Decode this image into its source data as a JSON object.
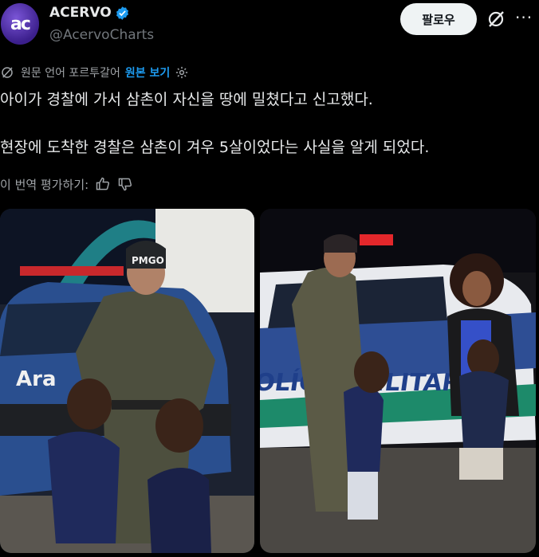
{
  "profile": {
    "avatar_text": "ac",
    "display_name": "ACERVO",
    "handle": "@AcervoCharts",
    "follow_label": "팔로우"
  },
  "translation": {
    "source_label": "원문 언어 포르투갈어",
    "show_original_label": "원본 보기"
  },
  "tweet": {
    "line1": "아이가 경찰에 가서 삼촌이 자신을 땅에 밀쳤다고 신고했다.",
    "line2": "현장에 도착한 경찰은 삼촌이 겨우 5살이었다는 사실을 알게 되었다."
  },
  "rate": {
    "label": "이 번역 평가하기:"
  },
  "colors": {
    "background": "#000000",
    "text": "#e7e9ea",
    "muted": "#71767b",
    "link": "#1d9bf0",
    "verified": "#1d9bf0"
  },
  "photos": {
    "left": {
      "cap_text": "PMGO",
      "car_text": "Ara"
    },
    "right": {
      "car_text": "POLÍCIA MILITAR"
    }
  }
}
